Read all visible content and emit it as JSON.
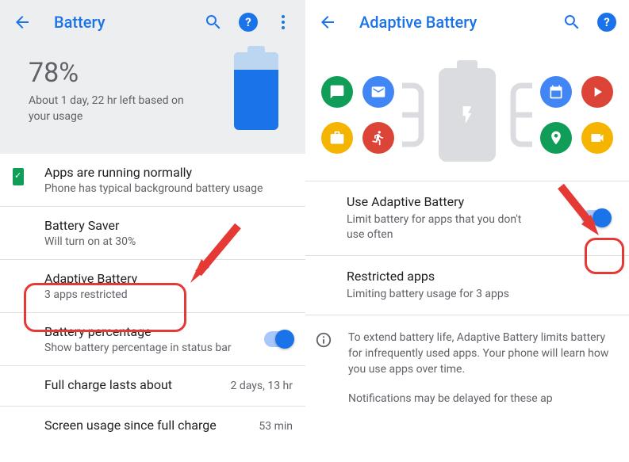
{
  "left": {
    "header": {
      "title": "Battery"
    },
    "hero": {
      "percent": "78%",
      "estimate": "About 1 day, 22 hr left based on your usage"
    },
    "status": {
      "title": "Apps are running normally",
      "sub": "Phone has typical background battery usage"
    },
    "saver": {
      "title": "Battery Saver",
      "sub": "Will turn on at 30%"
    },
    "adaptive": {
      "title": "Adaptive Battery",
      "sub": "3 apps restricted"
    },
    "percentRow": {
      "title": "Battery percentage",
      "sub": "Show battery percentage in status bar"
    },
    "fullCharge": {
      "title": "Full charge lasts about",
      "value": "2 days, 13 hr"
    },
    "screenUsage": {
      "title": "Screen usage since full charge",
      "value": "53 min"
    }
  },
  "right": {
    "header": {
      "title": "Adaptive Battery"
    },
    "useAdaptive": {
      "title": "Use Adaptive Battery",
      "sub": "Limit battery for apps that you don't use often"
    },
    "restricted": {
      "title": "Restricted apps",
      "sub": "Limiting battery usage for 3 apps"
    },
    "info": {
      "p1": "To extend battery life, Adaptive Battery limits battery for infrequently used apps. Your phone will learn how you use apps over time.",
      "p2": "Notifications may be delayed for these ap"
    }
  },
  "colors": {
    "green": "#0f9d58",
    "blue": "#1a73e8",
    "yellow": "#f4b400",
    "red": "#db4437"
  }
}
